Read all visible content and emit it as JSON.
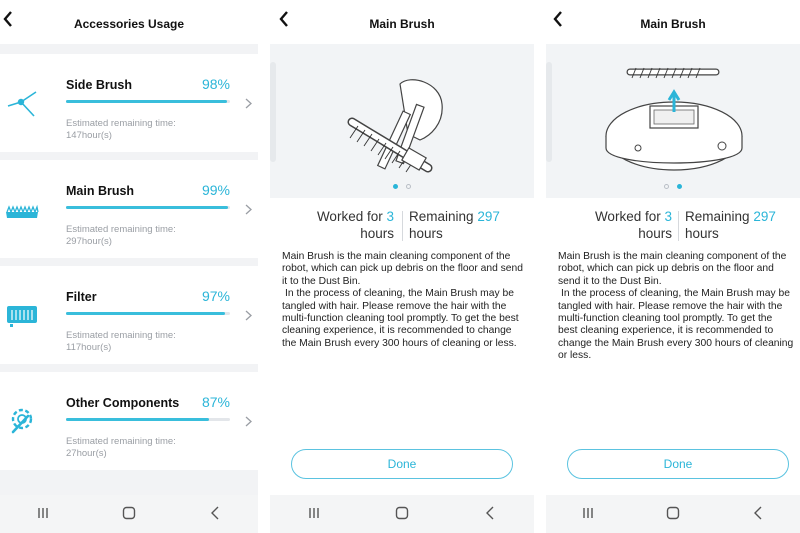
{
  "colors": {
    "accent": "#2bb5d8",
    "bar_track": "#e3e6ea",
    "background": "#f2f3f5"
  },
  "usage_screen": {
    "title": "Accessories Usage",
    "items": [
      {
        "name": "Side Brush",
        "percent_label": "98%",
        "remaining": 0.98,
        "est_label": "Estimated remaining time:",
        "est_value": "147hour(s)",
        "icon": "side-brush-icon"
      },
      {
        "name": "Main Brush",
        "percent_label": "99%",
        "remaining": 0.99,
        "est_label": "Estimated remaining time:",
        "est_value": "297hour(s)",
        "icon": "main-brush-icon"
      },
      {
        "name": "Filter",
        "percent_label": "97%",
        "remaining": 0.97,
        "est_label": "Estimated remaining time:",
        "est_value": "117hour(s)",
        "icon": "filter-icon"
      },
      {
        "name": "Other Components",
        "percent_label": "87%",
        "remaining": 0.87,
        "est_label": "Estimated remaining time:",
        "est_value": "27hour(s)",
        "icon": "other-components-icon"
      }
    ]
  },
  "detail_screens": [
    {
      "title": "Main Brush",
      "active_dot": 0,
      "worked_prefix": "Worked for",
      "worked_value": "3",
      "worked_unit": "hours",
      "remaining_prefix": "Remaining",
      "remaining_value": "297",
      "remaining_unit": "hours",
      "paragraph1": "Main Brush is the main cleaning component of the robot, which can pick up debris on the floor and send it to the Dust Bin.",
      "paragraph2": "In the process of cleaning, the Main Brush may be tangled with hair. Please remove the hair with the multi-function cleaning tool promptly. To get the best cleaning experience, it is recommended to change the Main Brush every 300 hours of cleaning or less.",
      "done_label": "Done"
    },
    {
      "title": "Main Brush",
      "active_dot": 1,
      "worked_prefix": "Worked for",
      "worked_value": "3",
      "worked_unit": "hours",
      "remaining_prefix": "Remaining",
      "remaining_value": "297",
      "remaining_unit": "hours",
      "paragraph1": "Main Brush is the main cleaning component of the robot, which can pick up debris on the floor and send it to the Dust Bin.",
      "paragraph2": "In the process of cleaning, the Main Brush may be tangled with hair. Please remove the hair with the multi-function cleaning tool promptly. To get the best cleaning experience, it is recommended to change the Main Brush every 300 hours of cleaning or less.",
      "done_label": "Done"
    }
  ],
  "navbar": {
    "icons": [
      "recent-apps-icon",
      "home-icon",
      "back-nav-icon"
    ]
  }
}
